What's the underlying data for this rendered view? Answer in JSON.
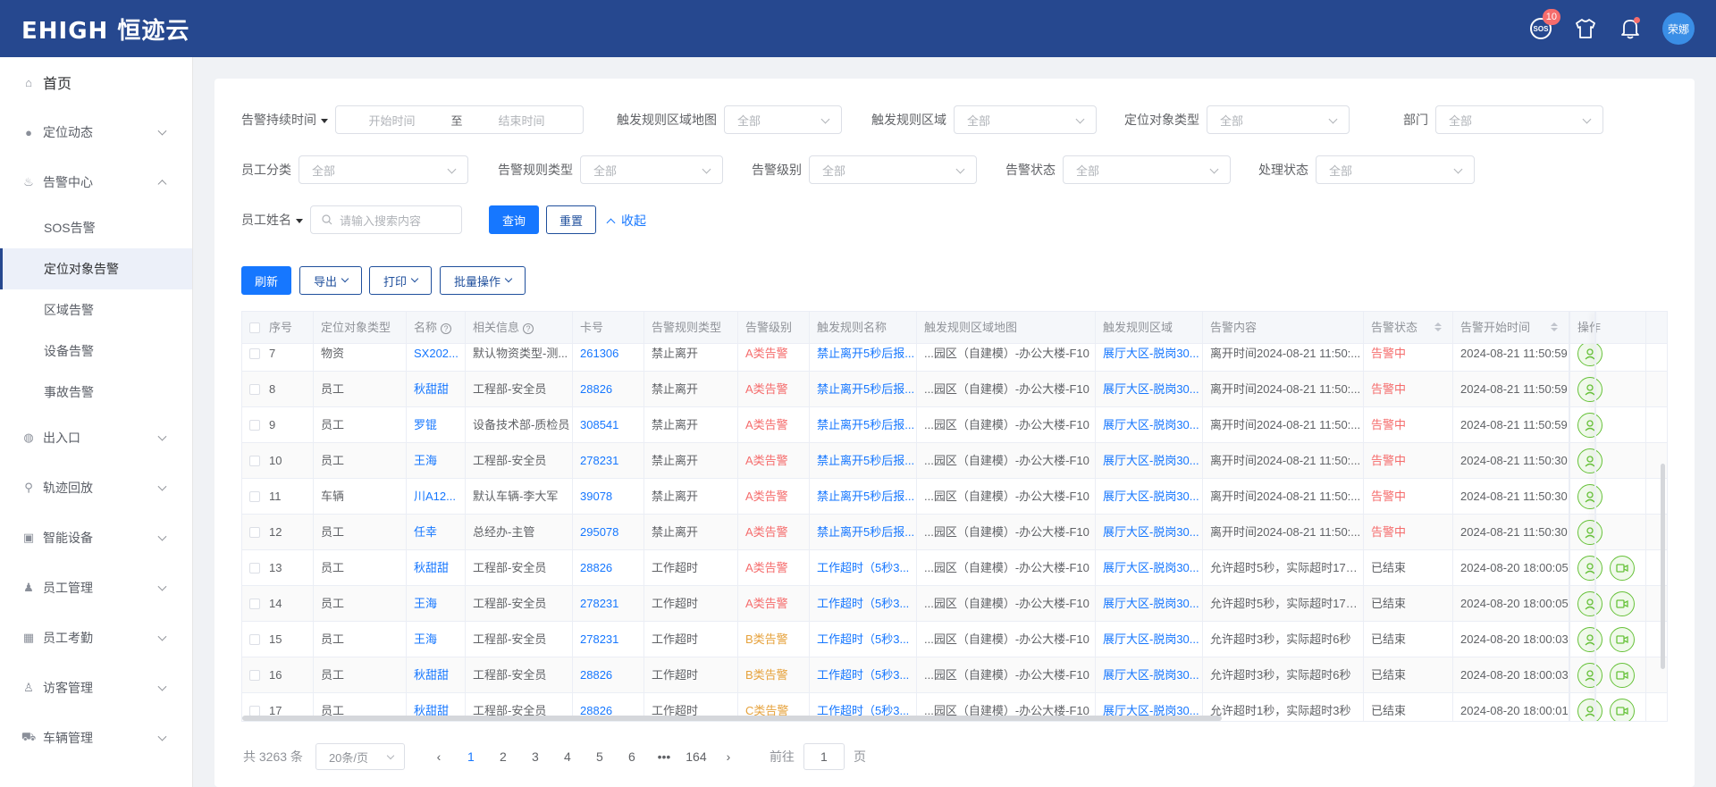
{
  "header": {
    "logo": "EHIGH 恒迹云",
    "sos_label": "SOS",
    "sos_badge": "10",
    "user_name": "荣娜"
  },
  "sidebar": {
    "home": "首页",
    "items": [
      {
        "label": "定位动态",
        "icon": "location-icon"
      },
      {
        "label": "告警中心",
        "icon": "alarm-icon",
        "expanded": true
      },
      {
        "label": "出入口",
        "icon": "globe-icon"
      },
      {
        "label": "轨迹回放",
        "icon": "track-icon"
      },
      {
        "label": "智能设备",
        "icon": "device-icon"
      },
      {
        "label": "员工管理",
        "icon": "user-icon"
      },
      {
        "label": "员工考勤",
        "icon": "calendar-icon"
      },
      {
        "label": "访客管理",
        "icon": "visitor-icon"
      },
      {
        "label": "车辆管理",
        "icon": "car-icon"
      }
    ],
    "alarm_sub": [
      "SOS告警",
      "定位对象告警",
      "区域告警",
      "设备告警",
      "事故告警"
    ],
    "active_sub": "定位对象告警"
  },
  "filters": {
    "duration_label": "告警持续时间",
    "start_placeholder": "开始时间",
    "to": "至",
    "end_placeholder": "结束时间",
    "rule_map_label": "触发规则区域地图",
    "rule_area_label": "触发规则区域",
    "object_type_label": "定位对象类型",
    "dept_label": "部门",
    "emp_category_label": "员工分类",
    "rule_type_label": "告警规则类型",
    "level_label": "告警级别",
    "status_label": "告警状态",
    "handle_label": "处理状态",
    "name_label": "员工姓名",
    "search_placeholder": "请输入搜索内容",
    "all": "全部",
    "query": "查询",
    "reset": "重置",
    "collapse": "收起"
  },
  "toolbar": {
    "refresh": "刷新",
    "export": "导出",
    "print": "打印",
    "batch": "批量操作"
  },
  "table": {
    "columns": [
      "序号",
      "定位对象类型",
      "名称",
      "相关信息",
      "卡号",
      "告警规则类型",
      "告警级别",
      "触发规则名称",
      "触发规则区域地图",
      "触发规则区域",
      "告警内容",
      "告警状态",
      "告警开始时间",
      "操作"
    ],
    "rows": [
      {
        "no": "7",
        "type": "物资",
        "name": "SX202...",
        "info": "默认物资类型-测...",
        "card": "261306",
        "rule_type": "禁止离开",
        "level": "A类告警",
        "rule_name": "禁止离开5秒后报...",
        "map": "...园区（自建模）-办公大楼-F10",
        "area": "展厅大区-脱岗30...",
        "content": "离开时间2024-08-21 11:50:...",
        "status": "告警中",
        "time": "2024-08-21 11:50:59"
      },
      {
        "no": "8",
        "type": "员工",
        "name": "秋甜甜",
        "info": "工程部-安全员",
        "card": "28826",
        "rule_type": "禁止离开",
        "level": "A类告警",
        "rule_name": "禁止离开5秒后报...",
        "map": "...园区（自建模）-办公大楼-F10",
        "area": "展厅大区-脱岗30...",
        "content": "离开时间2024-08-21 11:50:...",
        "status": "告警中",
        "time": "2024-08-21 11:50:59"
      },
      {
        "no": "9",
        "type": "员工",
        "name": "罗锟",
        "info": "设备技术部-质检员",
        "card": "308541",
        "rule_type": "禁止离开",
        "level": "A类告警",
        "rule_name": "禁止离开5秒后报...",
        "map": "...园区（自建模）-办公大楼-F10",
        "area": "展厅大区-脱岗30...",
        "content": "离开时间2024-08-21 11:50:...",
        "status": "告警中",
        "time": "2024-08-21 11:50:59"
      },
      {
        "no": "10",
        "type": "员工",
        "name": "王海",
        "info": "工程部-安全员",
        "card": "278231",
        "rule_type": "禁止离开",
        "level": "A类告警",
        "rule_name": "禁止离开5秒后报...",
        "map": "...园区（自建模）-办公大楼-F10",
        "area": "展厅大区-脱岗30...",
        "content": "离开时间2024-08-21 11:50:...",
        "status": "告警中",
        "time": "2024-08-21 11:50:30"
      },
      {
        "no": "11",
        "type": "车辆",
        "name": "川A12...",
        "info": "默认车辆-李大军",
        "card": "39078",
        "rule_type": "禁止离开",
        "level": "A类告警",
        "rule_name": "禁止离开5秒后报...",
        "map": "...园区（自建模）-办公大楼-F10",
        "area": "展厅大区-脱岗30...",
        "content": "离开时间2024-08-21 11:50:...",
        "status": "告警中",
        "time": "2024-08-21 11:50:30"
      },
      {
        "no": "12",
        "type": "员工",
        "name": "任幸",
        "info": "总经办-主管",
        "card": "295078",
        "rule_type": "禁止离开",
        "level": "A类告警",
        "rule_name": "禁止离开5秒后报...",
        "map": "...园区（自建模）-办公大楼-F10",
        "area": "展厅大区-脱岗30...",
        "content": "离开时间2024-08-21 11:50:...",
        "status": "告警中",
        "time": "2024-08-21 11:50:30"
      },
      {
        "no": "13",
        "type": "员工",
        "name": "秋甜甜",
        "info": "工程部-安全员",
        "card": "28826",
        "rule_type": "工作超时",
        "level": "A类告警",
        "rule_name": "工作超时（5秒3...",
        "map": "...园区（自建模）-办公大楼-F10",
        "area": "展厅大区-脱岗30...",
        "content": "允许超时5秒，实际超时17小...",
        "status": "已结束",
        "time": "2024-08-20 18:00:05"
      },
      {
        "no": "14",
        "type": "员工",
        "name": "王海",
        "info": "工程部-安全员",
        "card": "278231",
        "rule_type": "工作超时",
        "level": "A类告警",
        "rule_name": "工作超时（5秒3...",
        "map": "...园区（自建模）-办公大楼-F10",
        "area": "展厅大区-脱岗30...",
        "content": "允许超时5秒，实际超时17小...",
        "status": "已结束",
        "time": "2024-08-20 18:00:05"
      },
      {
        "no": "15",
        "type": "员工",
        "name": "王海",
        "info": "工程部-安全员",
        "card": "278231",
        "rule_type": "工作超时",
        "level": "B类告警",
        "rule_name": "工作超时（5秒3...",
        "map": "...园区（自建模）-办公大楼-F10",
        "area": "展厅大区-脱岗30...",
        "content": "允许超时3秒，实际超时6秒",
        "status": "已结束",
        "time": "2024-08-20 18:00:03"
      },
      {
        "no": "16",
        "type": "员工",
        "name": "秋甜甜",
        "info": "工程部-安全员",
        "card": "28826",
        "rule_type": "工作超时",
        "level": "B类告警",
        "rule_name": "工作超时（5秒3...",
        "map": "...园区（自建模）-办公大楼-F10",
        "area": "展厅大区-脱岗30...",
        "content": "允许超时3秒，实际超时6秒",
        "status": "已结束",
        "time": "2024-08-20 18:00:03"
      },
      {
        "no": "17",
        "type": "员工",
        "name": "秋甜甜",
        "info": "工程部-安全员",
        "card": "28826",
        "rule_type": "工作超时",
        "level": "C类告警",
        "rule_name": "工作超时（5秒3...",
        "map": "...园区（自建模）-办公大楼-F10",
        "area": "展厅大区-脱岗30...",
        "content": "允许超时1秒，实际超时3秒",
        "status": "已结束",
        "time": "2024-08-20 18:00:01"
      }
    ]
  },
  "pagination": {
    "total": "共 3263 条",
    "page_size": "20条/页",
    "pages": [
      "1",
      "2",
      "3",
      "4",
      "5",
      "6",
      "•••",
      "164"
    ],
    "current": "1",
    "goto_label": "前往",
    "goto_value": "1",
    "page_unit": "页"
  },
  "colors": {
    "header_bg": "#26488f",
    "primary": "#1677ff",
    "danger": "#f56c6c",
    "warning": "#e6a23c",
    "success": "#67c23a"
  }
}
